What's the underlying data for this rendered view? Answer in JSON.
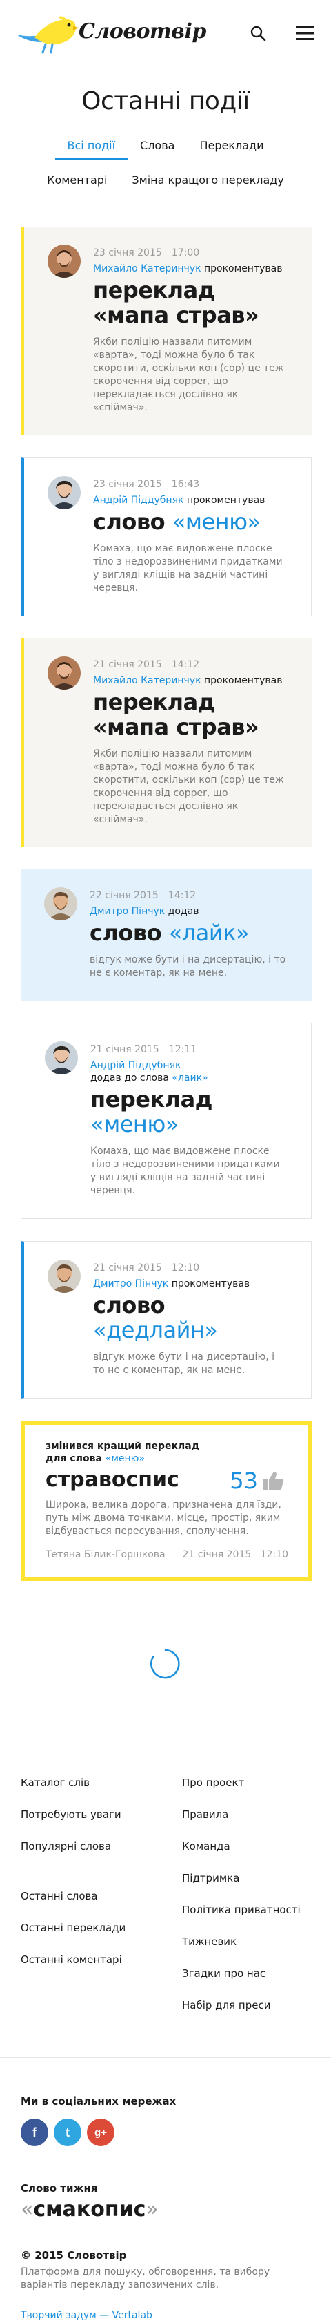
{
  "header": {
    "logo_text": "Словотвір",
    "search_icon": "search-icon",
    "menu_icon": "hamburger-menu-icon"
  },
  "page_title": "Останні події",
  "tabs": [
    {
      "label": "Всі події",
      "active": true
    },
    {
      "label": "Слова",
      "active": false
    },
    {
      "label": "Переклади",
      "active": false
    },
    {
      "label": "Коментарі",
      "active": false
    },
    {
      "label": "Зміна кращого перекладу",
      "active": false
    }
  ],
  "events": [
    {
      "style": "gray",
      "date": "23 січня 2015",
      "time": "17:00",
      "author": "Михайло Катеринчук",
      "verb": "прокоментував",
      "kind": "переклад",
      "word": "«мапа страв»",
      "word_dark": true,
      "text": "Якби поліцію назвали питомим «варта», тоді можна було б так скоротити, оскільки коп (cop) це теж скорочення від copper, що перекладається дослівно як «спіймач»."
    },
    {
      "style": "white",
      "date": "23 січня 2015",
      "time": "16:43",
      "author": "Андрій Піддубняк",
      "verb": "прокоментував",
      "kind": "слово",
      "word": "«меню»",
      "word_dark": false,
      "text": "Комаха, що має видовжене плоске тіло з недорозвиненими придатками у вигляді кліщів на задній частині черевця."
    },
    {
      "style": "gray",
      "date": "21 січня 2015",
      "time": "14:12",
      "author": "Михайло Катеринчук",
      "verb": "прокоментував",
      "kind": "переклад",
      "word": "«мапа страв»",
      "word_dark": true,
      "text": "Якби поліцію назвали питомим «варта», тоді можна було б так скоротити, оскільки коп (cop) це теж скорочення від copper, що перекладається дослівно як «спіймач»."
    },
    {
      "style": "blue",
      "date": "22 січня 2015",
      "time": "14:12",
      "author": "Дмитро Пінчук",
      "verb": "додав",
      "kind": "слово",
      "word": "«лайк»",
      "word_dark": false,
      "text": "відгук може бути і на дисертацію, і то не є коментар, як на мене."
    },
    {
      "style": "white",
      "date": "21 січня 2015",
      "time": "12:11",
      "author": "Андрій Піддубняк",
      "verb": "додав до слова",
      "verb_link": "«лайк»",
      "kind": "переклад",
      "word": "«меню»",
      "word_dark": false,
      "text": "Комаха, що має видовжене плоске тіло з недорозвиненими придатками у вигляді кліщів на задній частині черевця."
    },
    {
      "style": "white",
      "date": "21 січня 2015",
      "time": "12:10",
      "author": "Дмитро Пінчук",
      "verb": "прокоментував",
      "kind": "слово",
      "word": "«дедлайн»",
      "word_dark": false,
      "text": "відгук може бути і на дисертацію, і то не є коментар, як на мене."
    }
  ],
  "best_translation": {
    "head_line1": "змінився кращий переклад",
    "head_line2": "для слова",
    "word_link": "«меню»",
    "translation": "стравоспис",
    "score": "53",
    "score_icon": "thumbs-up-icon",
    "text": "Широка, велика дорога, призначена для їзди, путь між двома точками, місце, простір, яким відбувається пересування, сполучення.",
    "author": "Тетяна Білик-Горшкова",
    "date": "21 січня 2015",
    "time": "12:10"
  },
  "footer": {
    "left_links": [
      "Каталог слів",
      "Потребують уваги",
      "Популярні слова",
      "Останні слова",
      "Останні переклади",
      "Останні коментарі"
    ],
    "right_links": [
      "Про проект",
      "Правила",
      "Команда",
      "Підтримка",
      "Політика приватності",
      "Тижневик",
      "Згадки про нас",
      "Набір для преси"
    ],
    "social_title": "Ми в соціальних мережах",
    "social": [
      {
        "name": "facebook-icon",
        "glyph": "f"
      },
      {
        "name": "twitter-icon",
        "glyph": "t"
      },
      {
        "name": "google-plus-icon",
        "glyph": "g+"
      }
    ],
    "word_of_week_title": "Слово тижня",
    "word_of_week": "смакопис",
    "copyright": "© 2015 Словотвір",
    "description": "Платформа для пошуку, обговорення, та вибору варіантів перекладу запозичених слів.",
    "credit": "Творчий задум — Vertalab"
  },
  "colors": {
    "accent_blue": "#1a8fde",
    "accent_yellow": "#ffe333",
    "card_gray": "#f6f5f1",
    "card_blue": "#e2f1fc"
  }
}
